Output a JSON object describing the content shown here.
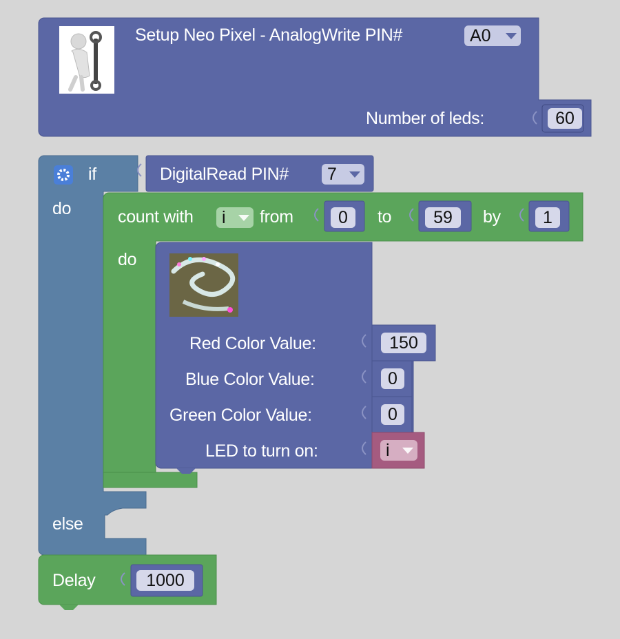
{
  "colors": {
    "setup_block": "#5b67a5",
    "if_block": "#5b80a5",
    "loop_block": "#5ba55b",
    "pixel_block": "#5b67a5",
    "variable_block": "#a55b80",
    "workspace_bg": "#ffffff",
    "field_bg": "#d6d8ea"
  },
  "setup": {
    "title": "Setup Neo Pixel - AnalogWrite PIN#",
    "pin_value": "A0",
    "leds_label": "Number of leds:",
    "leds_value": "60",
    "image_icon": "repair-figure-wrench-image"
  },
  "if_block": {
    "gear_icon": "gear-icon",
    "if_label": "if",
    "do_label": "do",
    "else_label": "else",
    "condition_label": "DigitalRead PIN#",
    "condition_pin": "7"
  },
  "loop": {
    "count_label": "count with",
    "var": "i",
    "from_label": "from",
    "from_value": "0",
    "to_label": "to",
    "to_value": "59",
    "by_label": "by",
    "by_value": "1",
    "do_label": "do"
  },
  "pixel": {
    "image_icon": "led-strip-image",
    "red_label": "Red Color Value:",
    "red_value": "150",
    "blue_label": "Blue Color Value:",
    "blue_value": "0",
    "green_label": "Green Color Value:",
    "green_value": "0",
    "led_label": "LED to turn on:",
    "led_var": "i"
  },
  "delay": {
    "label": "Delay",
    "value": "1000"
  }
}
